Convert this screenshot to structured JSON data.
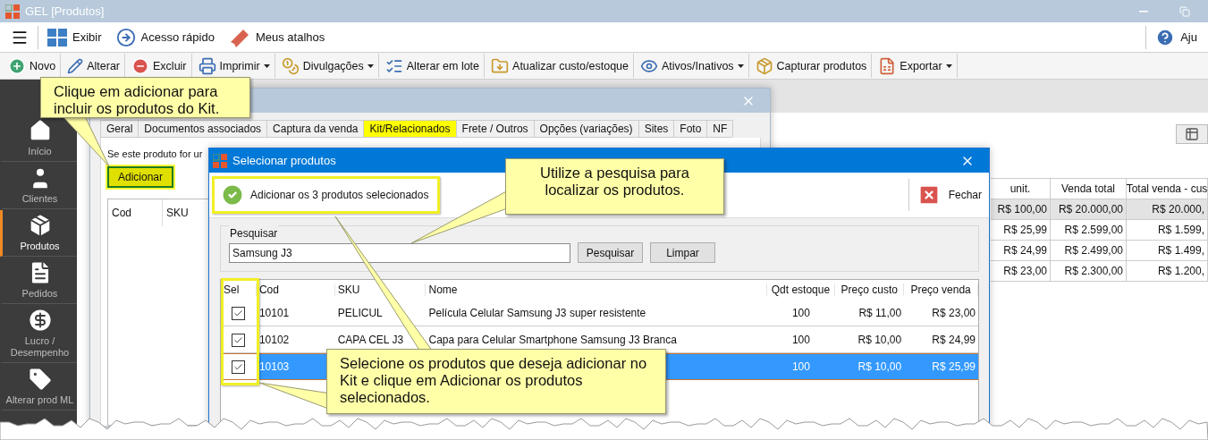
{
  "window": {
    "title": "GEL [Produtos]"
  },
  "menubar": [
    {
      "label": "Exibir"
    },
    {
      "label": "Acesso rápido"
    },
    {
      "label": "Meus atalhos"
    }
  ],
  "help_label": "Aju",
  "toolbar": [
    {
      "label": "Novo",
      "dropdown": false
    },
    {
      "label": "Alterar",
      "dropdown": false
    },
    {
      "label": "Excluir",
      "dropdown": false
    },
    {
      "label": "Imprimir",
      "dropdown": true
    },
    {
      "label": "Divulgações",
      "dropdown": true
    },
    {
      "label": "Alterar em lote",
      "dropdown": false
    },
    {
      "label": "Atualizar custo/estoque",
      "dropdown": false
    },
    {
      "label": "Ativos/Inativos",
      "dropdown": true
    },
    {
      "label": "Capturar produtos",
      "dropdown": false
    },
    {
      "label": "Exportar",
      "dropdown": true
    }
  ],
  "sidebar": {
    "items": [
      {
        "label": "Início",
        "selected": false
      },
      {
        "label": "Clientes",
        "selected": false
      },
      {
        "label": "Produtos",
        "selected": true
      },
      {
        "label": "Pedidos",
        "selected": false
      },
      {
        "label": "Lucro / Desempenho",
        "selected": false
      },
      {
        "label": "Alterar prod ML",
        "selected": false
      }
    ]
  },
  "background_table": {
    "columns": [
      "unit.",
      "Venda total",
      "Total venda - cus"
    ],
    "rows": [
      {
        "selected": true,
        "cells": [
          "R$ 100,00",
          "R$ 20.000,00",
          "R$ 20.000,"
        ]
      },
      {
        "selected": false,
        "cells": [
          "R$ 25,99",
          "R$ 2.599,00",
          "R$ 1.599,"
        ]
      },
      {
        "selected": false,
        "cells": [
          "R$ 24,99",
          "R$ 2.499,00",
          "R$ 1.499,"
        ]
      },
      {
        "selected": false,
        "cells": [
          "R$ 23,00",
          "R$ 2.300,00",
          "R$ 1.200,"
        ]
      }
    ]
  },
  "product_dialog": {
    "tabs": [
      {
        "label": "Geral",
        "selected": false
      },
      {
        "label": "Documentos associados",
        "selected": false
      },
      {
        "label": "Captura da venda",
        "selected": false
      },
      {
        "label": "Kit/Relacionados",
        "selected": true
      },
      {
        "label": "Frete / Outros",
        "selected": false
      },
      {
        "label": "Opções (variações)",
        "selected": false
      },
      {
        "label": "Sites",
        "selected": false
      },
      {
        "label": "Foto",
        "selected": false
      },
      {
        "label": "NF",
        "selected": false
      }
    ],
    "kit_text": "Se este produto for ur",
    "add_button": "Adicionar",
    "grid_columns": [
      "Cod",
      "SKU"
    ]
  },
  "select_dialog": {
    "title": "Selecionar produtos",
    "add_selected_button": "Adicionar os 3 produtos selecionados",
    "close_button": "Fechar",
    "search": {
      "label": "Pesquisar",
      "value": "Samsung J3",
      "buttons": [
        "Pesquisar",
        "Limpar"
      ]
    },
    "table": {
      "columns": [
        "Sel",
        "Cod",
        "SKU",
        "Nome",
        "Qdt estoque",
        "Preço custo",
        "Preço venda"
      ],
      "rows": [
        {
          "checked": true,
          "selected": false,
          "cod": "10101",
          "sku": "PELICUL",
          "nome": "Película Celular Samsung J3 super resistente",
          "qdt": "100",
          "custo": "R$ 11,00",
          "venda": "R$ 23,00"
        },
        {
          "checked": true,
          "selected": false,
          "cod": "10102",
          "sku": "CAPA CEL J3",
          "nome": "Capa para Celular Smartphone Samsung J3 Branca",
          "qdt": "100",
          "custo": "R$ 10,00",
          "venda": "R$ 24,99"
        },
        {
          "checked": true,
          "selected": true,
          "cod": "10103",
          "qdt": "100",
          "custo": "R$ 10,00",
          "venda": "R$ 25,99"
        }
      ]
    }
  },
  "callouts": [
    {
      "text": "Clique em adicionar para incluir os produtos do Kit."
    },
    {
      "text": "Utilize a pesquisa para localizar os produtos."
    },
    {
      "text": "Selecione os produtos que deseja adicionar no Kit e clique em Adicionar os produtos selecionados."
    }
  ]
}
